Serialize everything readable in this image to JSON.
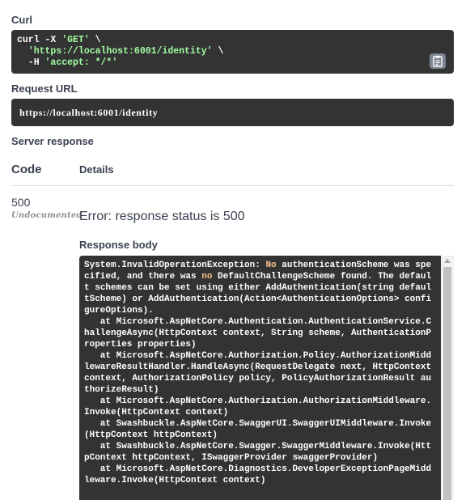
{
  "curl": {
    "label": "Curl",
    "line1_cmd": "curl -X ",
    "line1_method": "'GET'",
    "line1_end": " \\",
    "line2_indent": "  ",
    "line2_url": "'https://localhost:6001/identity'",
    "line2_end": " \\",
    "line3_cmd": "  -H ",
    "line3_header": "'accept: */*'",
    "copy_icon": "clipboard-icon"
  },
  "request_url": {
    "label": "Request URL",
    "value": "https://localhost:6001/identity"
  },
  "server_response": {
    "label": "Server response",
    "col_code": "Code",
    "col_details": "Details",
    "code": "500",
    "undocumented": "Undocumented",
    "error_text": "Error: response status is 500",
    "body_label": "Response body",
    "body_exception": "System.InvalidOperationException:",
    "body_no1": "No",
    "body_rest1": " authenticationScheme was spe",
    "body_line2a": "cified, and there was ",
    "body_no2": "no",
    "body_line2b": " DefaultChallengeScheme found. The defaul",
    "body_lines": [
      "t schemes can be set using either AddAuthentication(string defaul",
      "tScheme) or AddAuthentication(Action<AuthenticationOptions> confi",
      "gureOptions).",
      "   at Microsoft.AspNetCore.Authentication.AuthenticationService.C",
      "hallengeAsync(HttpContext context, String scheme, AuthenticationP",
      "roperties properties)",
      "   at Microsoft.AspNetCore.Authorization.Policy.AuthorizationMidd",
      "lewareResultHandler.HandleAsync(RequestDelegate next, HttpContext",
      "context, AuthorizationPolicy policy, PolicyAuthorizationResult au",
      "thorizeResult)",
      "   at Microsoft.AspNetCore.Authorization.AuthorizationMiddleware.",
      "Invoke(HttpContext context)",
      "   at Swashbuckle.AspNetCore.SwaggerUI.SwaggerUIMiddleware.Invoke",
      "(HttpContext httpContext)",
      "   at Swashbuckle.AspNetCore.Swagger.SwaggerMiddleware.Invoke(Htt",
      "pContext httpContext, ISwaggerProvider swaggerProvider)",
      "   at Microsoft.AspNetCore.Diagnostics.DeveloperExceptionPageMidd",
      "leware.Invoke(HttpContext context)"
    ]
  },
  "colors": {
    "block_bg": "#333333",
    "string_green": "#a2fca2",
    "keyword_orange": "#fcc28c",
    "text": "#3b4151"
  }
}
